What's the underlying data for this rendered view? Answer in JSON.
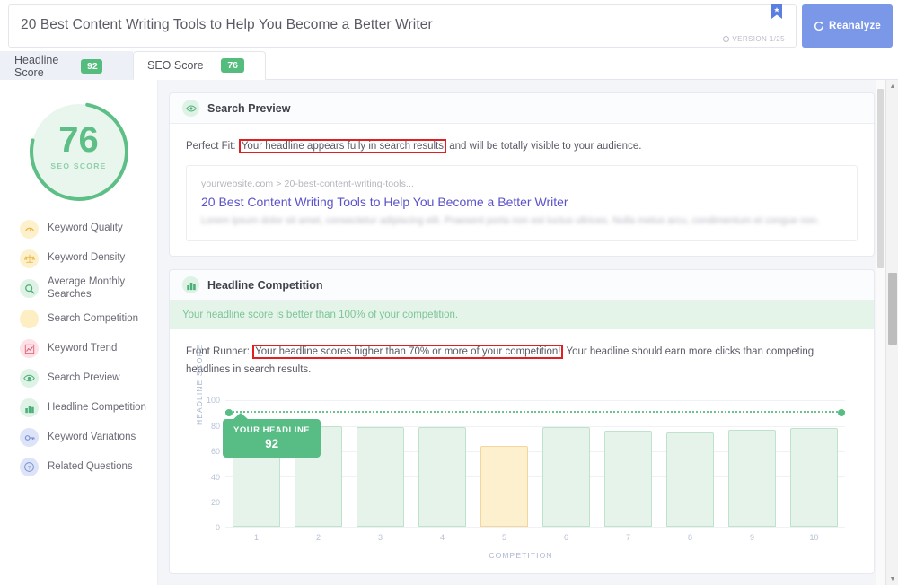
{
  "header": {
    "title": "20 Best Content Writing Tools to Help You Become a Better Writer",
    "version": "VERSION 1/25",
    "reanalyze_label": "Reanalyze",
    "bookmark_icon": "bookmark-icon",
    "refresh_icon": "refresh-icon"
  },
  "tabs": [
    {
      "label": "Headline Score",
      "score": "92",
      "active": false
    },
    {
      "label": "SEO Score",
      "score": "76",
      "active": true
    }
  ],
  "sidebar": {
    "gauge": {
      "value": "76",
      "caption": "SEO SCORE",
      "percent": 76,
      "color": "#5dbf86"
    },
    "items": [
      {
        "label": "Keyword Quality",
        "icon": "gauge-icon",
        "icon_bg": "#fdf1cd",
        "icon_color": "#e8b545"
      },
      {
        "label": "Keyword Density",
        "icon": "scales-icon",
        "icon_bg": "#fdf1cd",
        "icon_color": "#e8b545"
      },
      {
        "label": "Average Monthly Searches",
        "icon": "search-icon",
        "icon_bg": "#dff2e6",
        "icon_color": "#4cae79"
      },
      {
        "label": "Search Competition",
        "icon": "blank-icon",
        "icon_bg": "#fdeec4",
        "icon_color": "#fdeec4"
      },
      {
        "label": "Keyword Trend",
        "icon": "trend-chart-icon",
        "icon_bg": "#fde1e6",
        "icon_color": "#e0556e"
      },
      {
        "label": "Search Preview",
        "icon": "eye-icon",
        "icon_bg": "#dff2e6",
        "icon_color": "#4cae79"
      },
      {
        "label": "Headline Competition",
        "icon": "bar-chart-icon",
        "icon_bg": "#dff2e6",
        "icon_color": "#4cae79"
      },
      {
        "label": "Keyword Variations",
        "icon": "key-icon",
        "icon_bg": "#dde4f7",
        "icon_color": "#7b93d6"
      },
      {
        "label": "Related Questions",
        "icon": "question-icon",
        "icon_bg": "#dde4f7",
        "icon_color": "#7b93d6"
      }
    ]
  },
  "search_preview": {
    "heading": "Search Preview",
    "heading_icon": "eye-icon",
    "verdict_label": "Perfect Fit:",
    "verdict_highlight": "Your headline appears fully in search results",
    "verdict_rest": " and will be totally visible to your audience.",
    "serp": {
      "url": "yourwebsite.com > 20-best-content-writing-tools...",
      "title": "20 Best Content Writing Tools to Help You Become a Better Writer",
      "description": "Lorem ipsum dolor sit amet, consectetur adipiscing elit. Praesent porta non est luctus ultrices. Nulla metus arcu, condimentum et congue non."
    }
  },
  "headline_competition": {
    "heading": "Headline Competition",
    "heading_icon": "bar-chart-icon",
    "banner": "Your headline score is better than 100% of your competition.",
    "verdict_label": "Front Runner:",
    "verdict_highlight": "Your headline scores higher than 70% or more of your competition!",
    "verdict_rest": " Your headline should earn more clicks than competing headlines in search results."
  },
  "chart_data": {
    "type": "bar",
    "title": "Headline Competition",
    "xlabel": "COMPETITION",
    "ylabel": "HEADLINE SCORE",
    "categories": [
      "1",
      "2",
      "3",
      "4",
      "5",
      "6",
      "7",
      "8",
      "9",
      "10"
    ],
    "values": [
      80,
      80,
      79,
      79,
      64,
      79,
      76,
      75,
      77,
      78
    ],
    "highlight_index": 4,
    "highlight_color": "#fdf0cf",
    "bar_color": "#e6f3ea",
    "bar_border": "#bfe2cc",
    "yticks": [
      0,
      20,
      40,
      60,
      80,
      100
    ],
    "ylim": [
      0,
      100
    ],
    "grid": true,
    "legend": "none",
    "marker": {
      "label": "YOUR HEADLINE",
      "value": 92,
      "value_text": "92",
      "color": "#57bd84",
      "style": "dotted-line-with-endpoints"
    }
  },
  "scrollbars": {
    "outer_up_icon": "scroll-up-arrow-icon",
    "outer_down_icon": "scroll-down-arrow-icon"
  }
}
